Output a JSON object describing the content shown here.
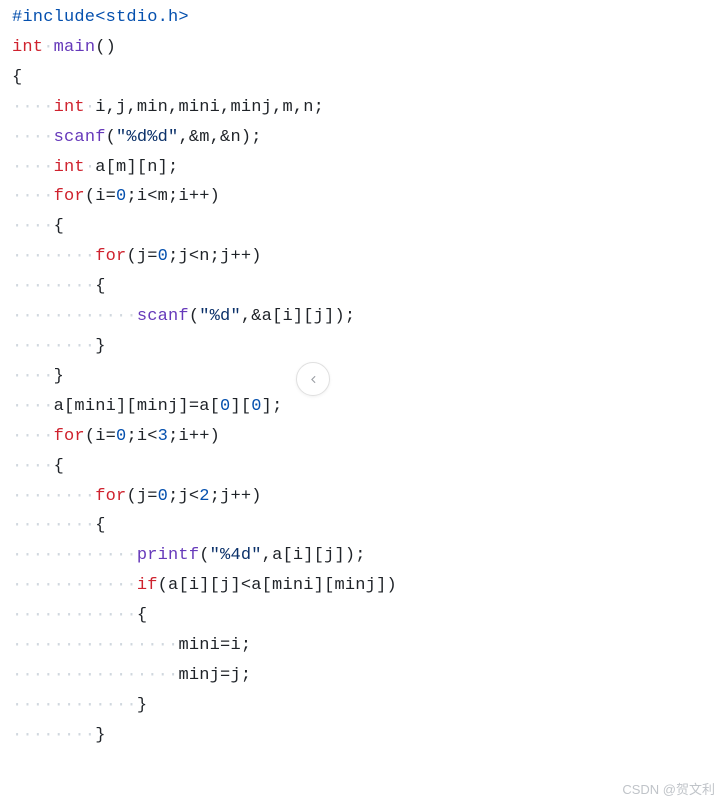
{
  "code": {
    "l01_include": "#include",
    "l01_hdr": "<stdio.h>",
    "l02_int": "int",
    "l02_main": "main",
    "l02_paren": "()",
    "l03_brace": "{",
    "l04_int": "int",
    "l04_vars": " i,j,min,mini,minj,m,n;",
    "l05_scanf": "scanf",
    "l05_open": "(",
    "l05_str": "\"%d%d\"",
    "l05_rest": ",&m,&n);",
    "l06_int": "int",
    "l06_arr": " a[m][n];",
    "l07_for": "for",
    "l07_a": "(i=",
    "l07_z": "0",
    "l07_b": ";i<m;i++)",
    "l08_brace": "{",
    "l09_for": "for",
    "l09_a": "(j=",
    "l09_z": "0",
    "l09_b": ";j<n;j++)",
    "l10_brace": "{",
    "l11_scanf": "scanf",
    "l11_open": "(",
    "l11_str": "\"%d\"",
    "l11_rest": ",&a[i][j]);",
    "l12_brace": "}",
    "l13_brace": "}",
    "l14_stmt_a": "a[mini][minj]=a[",
    "l14_z1": "0",
    "l14_mid": "][",
    "l14_z2": "0",
    "l14_end": "];",
    "l15_for": "for",
    "l15_a": "(i=",
    "l15_z": "0",
    "l15_b": ";i<",
    "l15_n": "3",
    "l15_c": ";i++)",
    "l16_brace": "{",
    "l17_for": "for",
    "l17_a": "(j=",
    "l17_z": "0",
    "l17_b": ";j<",
    "l17_n": "2",
    "l17_c": ";j++)",
    "l18_brace": "{",
    "l19_printf": "printf",
    "l19_open": "(",
    "l19_str": "\"%4d\"",
    "l19_rest": ",a[i][j]);",
    "l20_if": "if",
    "l20_cond": "(a[i][j]<a[mini][minj])",
    "l21_brace": "{",
    "l22_stmt": "mini=i;",
    "l23_stmt": "minj=j;",
    "l24_brace": "}",
    "l25_brace": "}"
  },
  "dots": {
    "d4": "····",
    "d8": "········",
    "d12": "············",
    "d16": "················",
    "d20": "····················"
  },
  "watermark": "CSDN @贺文利"
}
